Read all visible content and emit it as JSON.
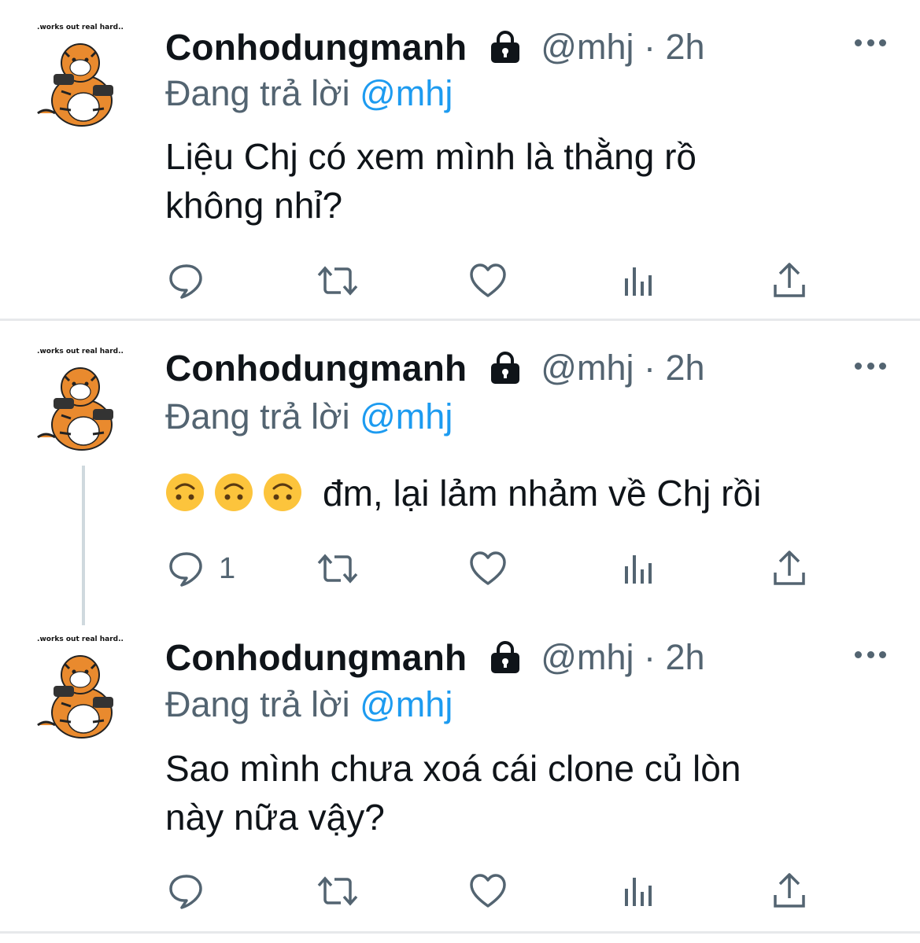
{
  "colors": {
    "text": "#0f1419",
    "secondary": "#536471",
    "mention": "#1d9bf0",
    "divider": "#e7e9eb",
    "thread_line": "#cfd9de"
  },
  "tweets": [
    {
      "avatar_caption": ".works out real hard..",
      "display_name": "Conhodungmanh",
      "lock_icon": "lock-icon",
      "handle_time": "@mhj · 2h",
      "reply_prefix": "Đang trả lời",
      "reply_mention": "@mhj",
      "text_line1": "Liệu Chj có xem mình là thằng rồ",
      "text_line2": "không nhỉ?",
      "reply_count": "",
      "icons": [
        "reply-icon",
        "retweet-icon",
        "like-icon",
        "analytics-icon",
        "share-icon"
      ]
    },
    {
      "avatar_caption": ".works out real hard..",
      "display_name": "Conhodungmanh",
      "lock_icon": "lock-icon",
      "handle_time": "@mhj · 2h",
      "reply_prefix": "Đang trả lời",
      "reply_mention": "@mhj",
      "emojis": [
        "upside-down-face-emoji",
        "upside-down-face-emoji",
        "upside-down-face-emoji"
      ],
      "text_line1": "đm, lại lảm nhảm về Chj rồi",
      "reply_count": "1",
      "icons": [
        "reply-icon",
        "retweet-icon",
        "like-icon",
        "analytics-icon",
        "share-icon"
      ]
    },
    {
      "avatar_caption": ".works out real hard..",
      "display_name": "Conhodungmanh",
      "lock_icon": "lock-icon",
      "handle_time": "@mhj · 2h",
      "reply_prefix": "Đang trả lời",
      "reply_mention": "@mhj",
      "text_line1": "Sao mình chưa xoá cái clone củ lòn",
      "text_line2": "này nữa vậy?",
      "reply_count": "",
      "icons": [
        "reply-icon",
        "retweet-icon",
        "like-icon",
        "analytics-icon",
        "share-icon"
      ]
    }
  ]
}
